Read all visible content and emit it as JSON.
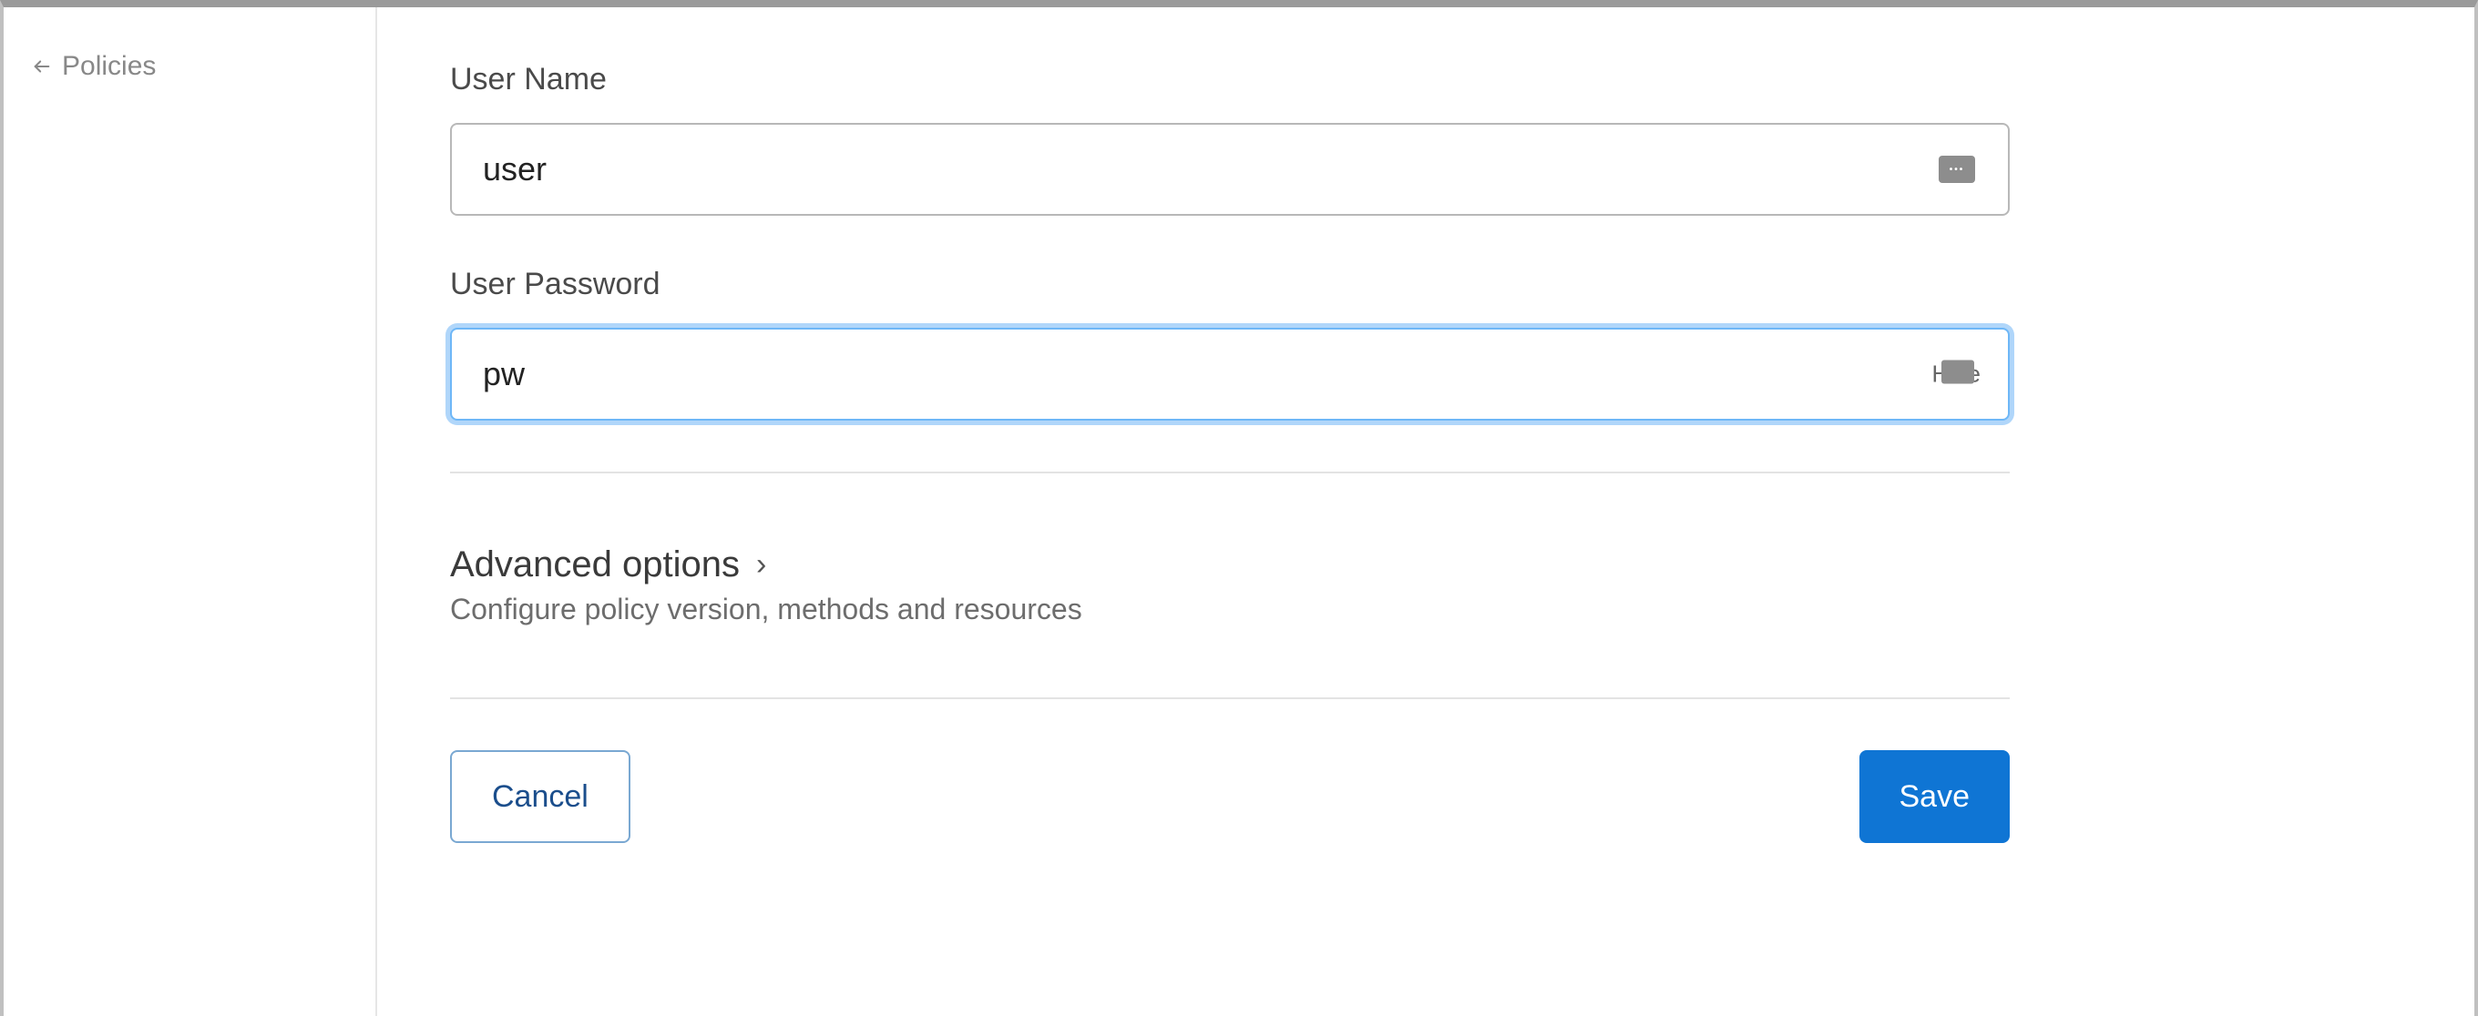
{
  "sidebar": {
    "back_label": "Policies"
  },
  "form": {
    "username_label": "User Name",
    "username_value": "user",
    "password_label": "User Password",
    "password_value": "pw",
    "password_toggle": "Hide"
  },
  "advanced": {
    "title": "Advanced options",
    "description": "Configure policy version, methods and resources"
  },
  "actions": {
    "cancel_label": "Cancel",
    "save_label": "Save"
  }
}
